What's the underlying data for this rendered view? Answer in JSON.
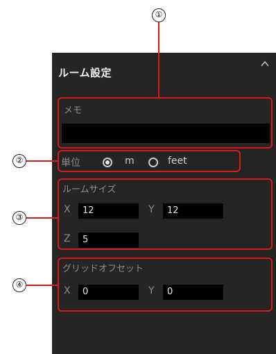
{
  "panel": {
    "title": "ルーム設定",
    "collapse_icon": "chevron-up-icon"
  },
  "memo": {
    "label": "メモ",
    "value": ""
  },
  "unit": {
    "label": "単位",
    "options": [
      {
        "label": "m",
        "selected": true
      },
      {
        "label": "feet",
        "selected": false
      }
    ]
  },
  "room_size": {
    "label": "ルームサイズ",
    "x_label": "X",
    "x_value": "12",
    "y_label": "Y",
    "y_value": "12",
    "z_label": "Z",
    "z_value": "5"
  },
  "grid_offset": {
    "label": "グリッドオフセット",
    "x_label": "X",
    "x_value": "0",
    "y_label": "Y",
    "y_value": "0"
  },
  "callouts": [
    "①",
    "②",
    "③",
    "④"
  ],
  "colors": {
    "panel_bg": "#252525",
    "highlight": "#d81b1b"
  }
}
